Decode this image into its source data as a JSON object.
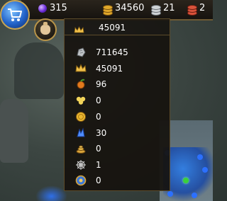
{
  "topbar": {
    "gems": "315",
    "gold": "34560",
    "silver": "21",
    "red": "2"
  },
  "crown_row": {
    "value": "45091"
  },
  "panel": {
    "items": [
      {
        "icon": "stone-icon",
        "value": "711645"
      },
      {
        "icon": "crown-icon",
        "value": "45091"
      },
      {
        "icon": "fruit-icon",
        "value": "96"
      },
      {
        "icon": "clover-icon",
        "value": "0"
      },
      {
        "icon": "gold-coin-icon",
        "value": "0"
      },
      {
        "icon": "blue-crystal-icon",
        "value": "30"
      },
      {
        "icon": "coin-pile-icon",
        "value": "0"
      },
      {
        "icon": "spiderweb-icon",
        "value": "1"
      },
      {
        "icon": "medallion-icon",
        "value": "0"
      }
    ]
  },
  "colors": {
    "gold": "#e0a82b",
    "frame": "#c7a453",
    "panel_bg": "#15120e"
  }
}
